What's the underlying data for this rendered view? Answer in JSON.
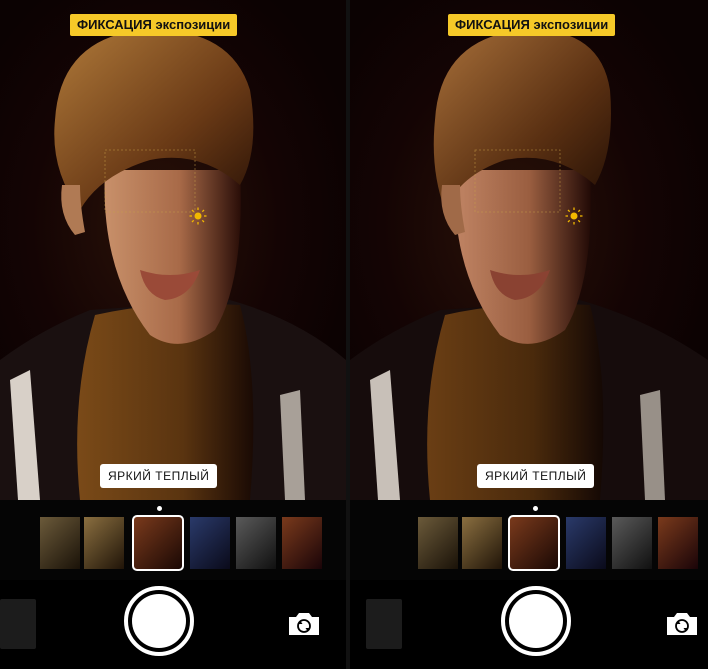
{
  "left_panel": {
    "exposure_lock_label": "ФИКСАЦИЯ экспозиции",
    "filter_name": "ЯРКИЙ ТЕПЛЫЙ"
  },
  "right_panel": {
    "exposure_lock_label": "ФИКСАЦИЯ экспозиции",
    "filter_name": "ЯРКИЙ ТЕПЛЫЙ"
  },
  "colors": {
    "accent_badge": "#f6c928",
    "sun_icon": "#f2b800",
    "background": "#000000"
  },
  "icons": {
    "exposure_control": "sun-icon",
    "camera_switch": "camera-flip-icon"
  },
  "filter_strip": {
    "thumbnail_tints": [
      "#6b5a3a",
      "#8a6f40",
      "#7a3a1c",
      "#2a3a6a",
      "#5a5a5a",
      "#3a2a4a"
    ],
    "selected_index": 2
  }
}
